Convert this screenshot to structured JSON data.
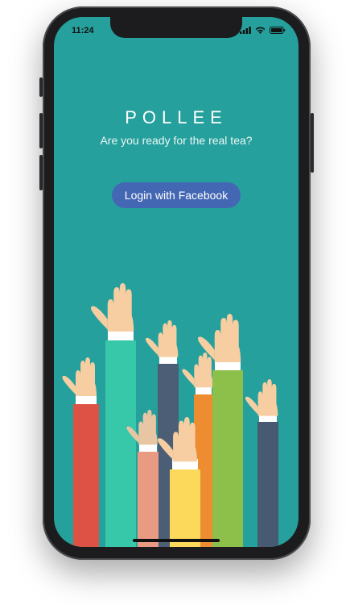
{
  "status_bar": {
    "time": "11:24",
    "icons": [
      "signal-icon",
      "wifi-icon",
      "battery-icon"
    ]
  },
  "app": {
    "title": "POLLEE",
    "tagline": "Are you ready for the real tea?",
    "login_button_label": "Login with Facebook"
  },
  "illustration": {
    "name": "raised-hands-illustration",
    "sleeve_colors": [
      "#de5246",
      "#36c8a8",
      "#e99a82",
      "#4b5e75",
      "#fcd95a",
      "#ed8c31",
      "#8cc04a",
      "#485a72"
    ],
    "skin_color": "#f7ceA1"
  },
  "colors": {
    "background": "#26a09c",
    "button": "#4467b4",
    "text": "#ffffff"
  }
}
